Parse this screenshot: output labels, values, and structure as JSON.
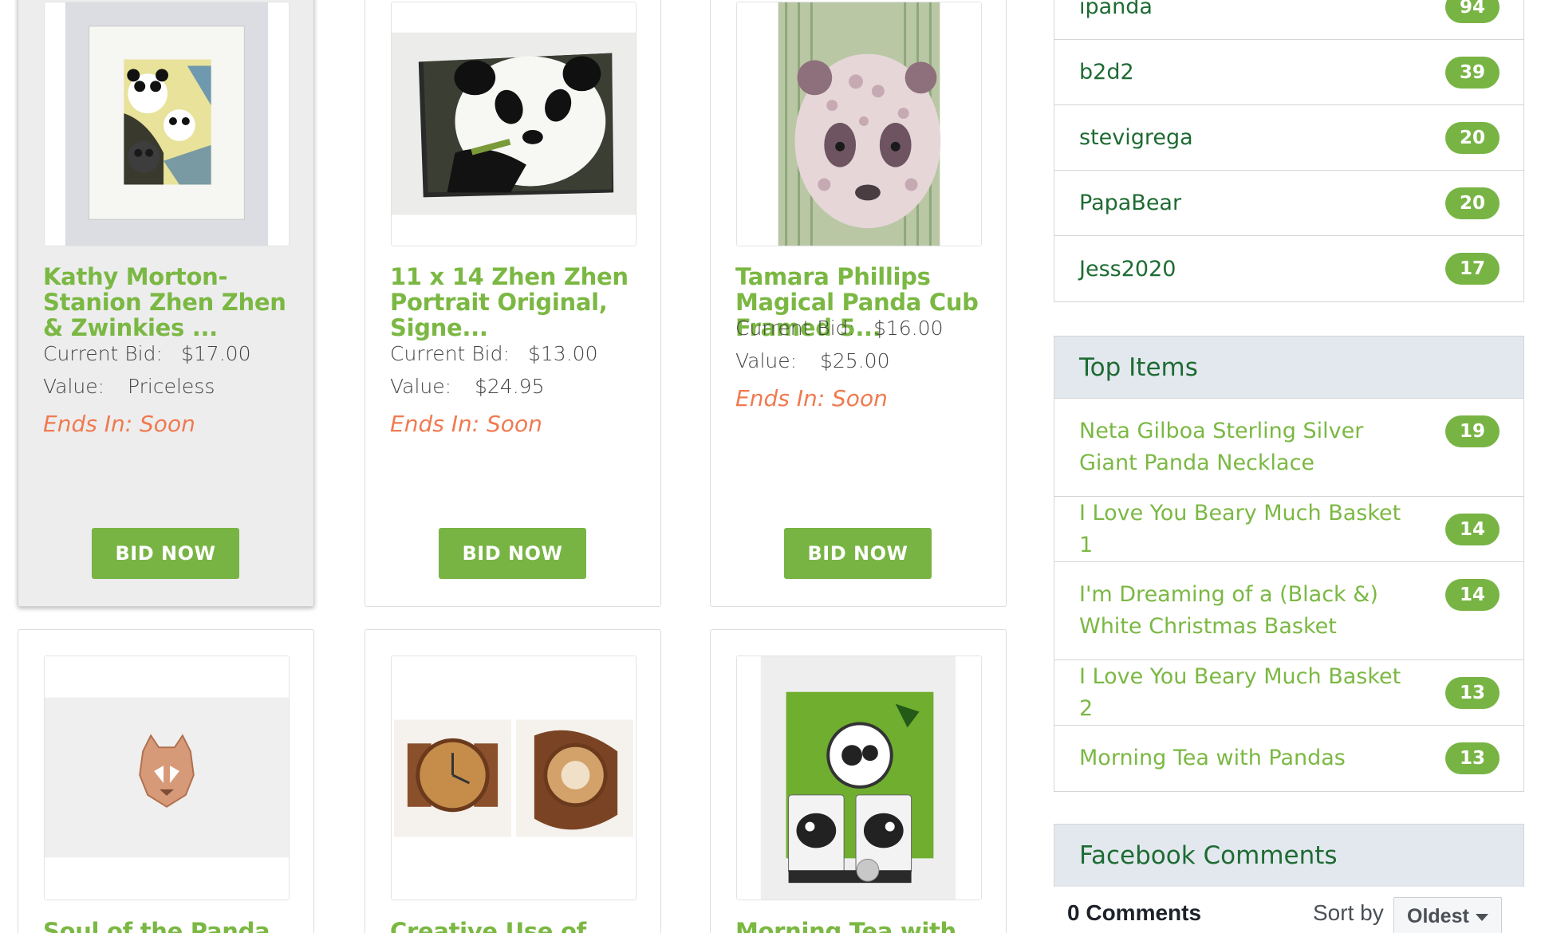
{
  "auction_items": [
    {
      "title": "Kathy Morton-Stanion Zhen Zhen & Zwinkies ...",
      "current_bid_label": "Current Bid:",
      "current_bid": "$17.00",
      "value_label": "Value:",
      "value": "Priceless",
      "ends": "Ends In: Soon",
      "button": "BID NOW"
    },
    {
      "title": "11 x 14 Zhen Zhen Portrait Original, Signe...",
      "current_bid_label": "Current Bid:",
      "current_bid": "$13.00",
      "value_label": "Value:",
      "value": "$24.95",
      "ends": "Ends In: Soon",
      "button": "BID NOW"
    },
    {
      "title": "Tamara Phillips Magical Panda Cub Framed 5...",
      "current_bid_label": "Current Bid:",
      "current_bid": "$16.00",
      "value_label": "Value:",
      "value": "$25.00",
      "ends": "Ends In: Soon",
      "button": "BID NOW"
    },
    {
      "title": "Soul of the Panda"
    },
    {
      "title": "Creative Use of"
    },
    {
      "title": "Morning Tea with"
    }
  ],
  "top_bidders": [
    {
      "name": "ipanda",
      "count": "94"
    },
    {
      "name": "b2d2",
      "count": "39"
    },
    {
      "name": "stevigrega",
      "count": "20"
    },
    {
      "name": "PapaBear",
      "count": "20"
    },
    {
      "name": "Jess2020",
      "count": "17"
    }
  ],
  "top_items": {
    "heading": "Top Items",
    "items": [
      {
        "name": "Neta Gilboa Sterling Silver Giant Panda Necklace",
        "count": "19"
      },
      {
        "name": "I Love You Beary Much Basket 1",
        "count": "14"
      },
      {
        "name": "I'm Dreaming of a (Black &) White Christmas Basket",
        "count": "14"
      },
      {
        "name": "I Love You Beary Much Basket 2",
        "count": "13"
      },
      {
        "name": "Morning Tea with Pandas",
        "count": "13"
      }
    ]
  },
  "facebook": {
    "heading": "Facebook Comments",
    "count_label": "0 Comments",
    "sort_label": "Sort by",
    "sort_value": "Oldest"
  },
  "colors": {
    "accent_green": "#78b444",
    "title_green": "#7bb843",
    "dark_green": "#1e6b33",
    "ends_orange": "#f07a50",
    "panel_header": "#e3e8ef"
  },
  "icons": {
    "sort_caret": "caret-down-icon"
  }
}
